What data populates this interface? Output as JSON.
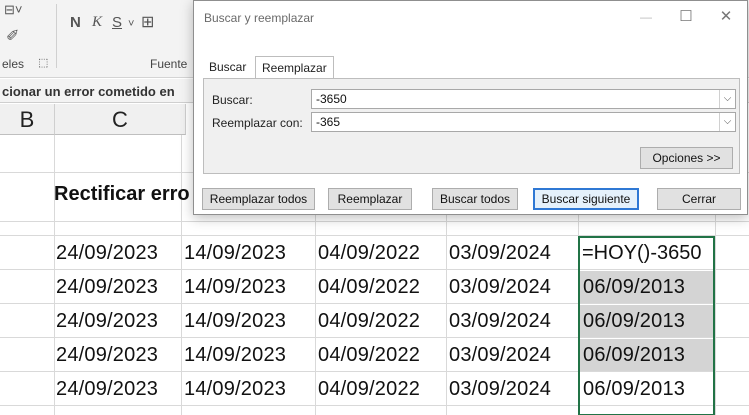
{
  "ribbon": {
    "group_label_left": "eles",
    "group_label_font": "Fuente",
    "bold": "N",
    "italic": "K",
    "underline": "S"
  },
  "error_bar": {
    "text": "cionar un error cometido en"
  },
  "columns": [
    "B",
    "C"
  ],
  "sheet": {
    "title": "Rectificar erro",
    "rows": [
      [
        "24/09/2023",
        "14/09/2023",
        "04/09/2022",
        "03/09/2024",
        "=HOY()-3650"
      ],
      [
        "24/09/2023",
        "14/09/2023",
        "04/09/2022",
        "03/09/2024",
        "06/09/2013"
      ],
      [
        "24/09/2023",
        "14/09/2023",
        "04/09/2022",
        "03/09/2024",
        "06/09/2013"
      ],
      [
        "24/09/2023",
        "14/09/2023",
        "04/09/2022",
        "03/09/2024",
        "06/09/2013"
      ],
      [
        "24/09/2023",
        "14/09/2023",
        "04/09/2022",
        "03/09/2024",
        "06/09/2013"
      ]
    ]
  },
  "dialog": {
    "title": "Buscar y reemplazar",
    "tabs": [
      "Buscar",
      "Reemplazar"
    ],
    "active_tab": "Reemplazar",
    "find_label": "Buscar:",
    "find_value": "-3650",
    "replace_label": "Reemplazar con:",
    "replace_value": "-365",
    "options_button": "Opciones >>",
    "buttons": {
      "replace_all": "Reemplazar todos",
      "replace": "Reemplazar",
      "find_all": "Buscar todos",
      "find_next": "Buscar siguiente",
      "close": "Cerrar"
    }
  },
  "colors": {
    "selection_border": "#217346",
    "primary_button_border": "#2f78d4"
  }
}
